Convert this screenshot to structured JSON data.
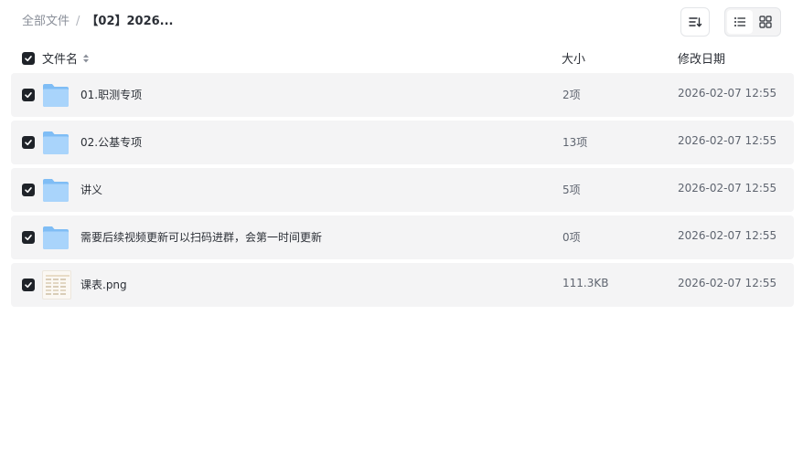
{
  "breadcrumb": {
    "root": "全部文件",
    "separator": "/",
    "current": "【02】2026..."
  },
  "toolbar": {
    "sort_icon": "sort-icon",
    "list_view_icon": "list-view-icon",
    "grid_view_icon": "grid-view-icon",
    "active_view": "list"
  },
  "table": {
    "headers": {
      "name": "文件名",
      "size": "大小",
      "modified": "修改日期"
    },
    "rows": [
      {
        "name": "01.职测专项",
        "size": "2项",
        "modified": "2026-02-07 12:55",
        "type": "folder",
        "checked": true
      },
      {
        "name": "02.公基专项",
        "size": "13项",
        "modified": "2026-02-07 12:55",
        "type": "folder",
        "checked": true
      },
      {
        "name": "讲义",
        "size": "5项",
        "modified": "2026-02-07 12:55",
        "type": "folder",
        "checked": true
      },
      {
        "name": "需要后续视频更新可以扫码进群，会第一时间更新",
        "size": "0项",
        "modified": "2026-02-07 12:55",
        "type": "folder",
        "checked": true
      },
      {
        "name": "课表.png",
        "size": "111.3KB",
        "modified": "2026-02-07 12:55",
        "type": "image",
        "checked": true
      }
    ]
  },
  "colors": {
    "row_bg": "#f4f4f5",
    "checkbox": "#1f2329",
    "folder_light": "#a9d4fb",
    "folder_dark": "#7fbdf5"
  }
}
